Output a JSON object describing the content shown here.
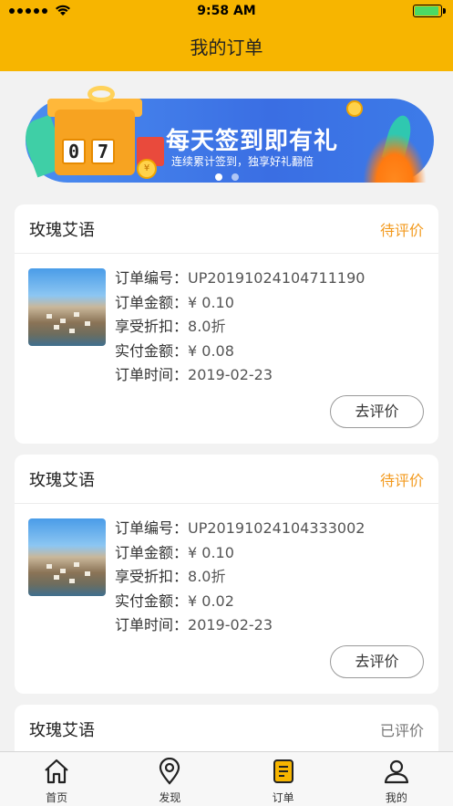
{
  "status_bar": {
    "time": "9:58 AM"
  },
  "header": {
    "title": "我的订单"
  },
  "banner": {
    "title": "每天签到即有礼",
    "subtitle": "连续累计签到，独享好礼翻倍",
    "digits": [
      "0",
      "7"
    ],
    "coin_symbol": "¥",
    "page_count": 2,
    "active_page": 1
  },
  "labels": {
    "order_no": "订单编号：",
    "amount": "订单金额：",
    "discount": "享受折扣：",
    "paid": "实付金额：",
    "time": "订单时间："
  },
  "orders": [
    {
      "shop": "玫瑰艾语",
      "status": "待评价",
      "status_color": "#f39a1e",
      "order_no": "UP20191024104711190",
      "amount": "¥ 0.10",
      "discount": "8.0折",
      "paid": "¥ 0.08",
      "time": "2019-02-23",
      "action": "去评价"
    },
    {
      "shop": "玫瑰艾语",
      "status": "待评价",
      "status_color": "#f39a1e",
      "order_no": "UP20191024104333002",
      "amount": "¥ 0.10",
      "discount": "8.0折",
      "paid": "¥ 0.02",
      "time": "2019-02-23",
      "action": "去评价"
    },
    {
      "shop": "玫瑰艾语",
      "status": "已评价",
      "status_color": "#777777"
    }
  ],
  "tabbar": {
    "items": [
      {
        "label": "首页",
        "icon": "home-icon"
      },
      {
        "label": "发现",
        "icon": "location-pin-icon"
      },
      {
        "label": "订单",
        "icon": "order-list-icon",
        "active": true
      },
      {
        "label": "我的",
        "icon": "user-icon"
      }
    ]
  },
  "colors": {
    "brand": "#f7b500",
    "accent": "#f39a1e"
  }
}
